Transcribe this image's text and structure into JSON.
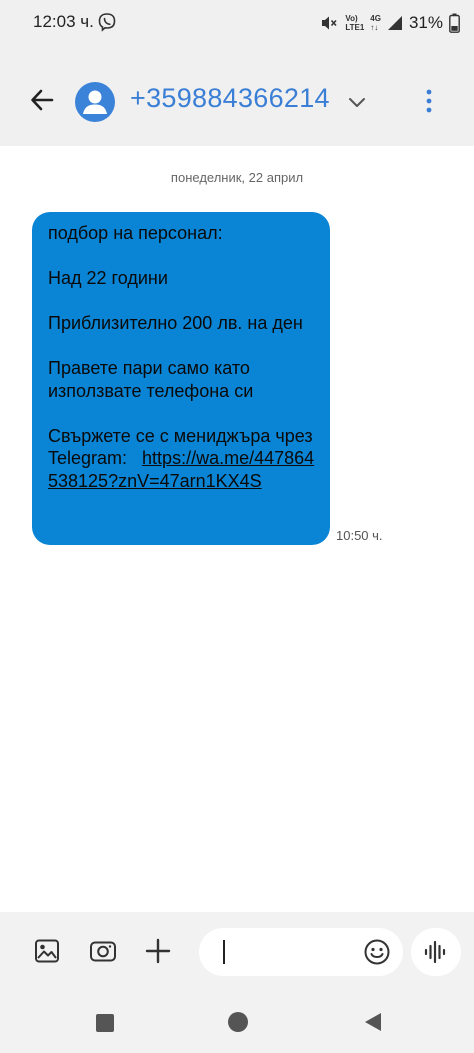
{
  "status_bar": {
    "time": "12:03 ч.",
    "net_top": "Vo)",
    "net_bottom": "LTE1",
    "signal_type": "4G",
    "battery": "31%",
    "icons": [
      "viber-icon",
      "mute-icon",
      "signal-icon",
      "battery-icon"
    ]
  },
  "header": {
    "contact": "+359884366214",
    "icons": [
      "back-arrow-icon",
      "person-icon",
      "chevron-down-icon",
      "more-vert-icon"
    ]
  },
  "conversation": {
    "date": "понеделник, 22 април",
    "message": {
      "lines": [
        "подбор на персонал:",
        "Над 22 години",
        "Приблизително 200 лв. на ден",
        "Правете пари само като използвате телефона си"
      ],
      "last_text": "Свържете се с мениджъра чрез Telegram:",
      "link": "https://wa.me/447864538125?znV=47arn1KX4S",
      "time": "10:50 ч."
    }
  },
  "compose": {
    "placeholder": "",
    "icons": [
      "gallery-icon",
      "camera-icon",
      "plus-icon",
      "emoji-icon",
      "voice-icon"
    ]
  },
  "colors": {
    "accent": "#3a7fd5",
    "bubble": "#0a84d4",
    "bar_background": "#f0f0f0"
  }
}
